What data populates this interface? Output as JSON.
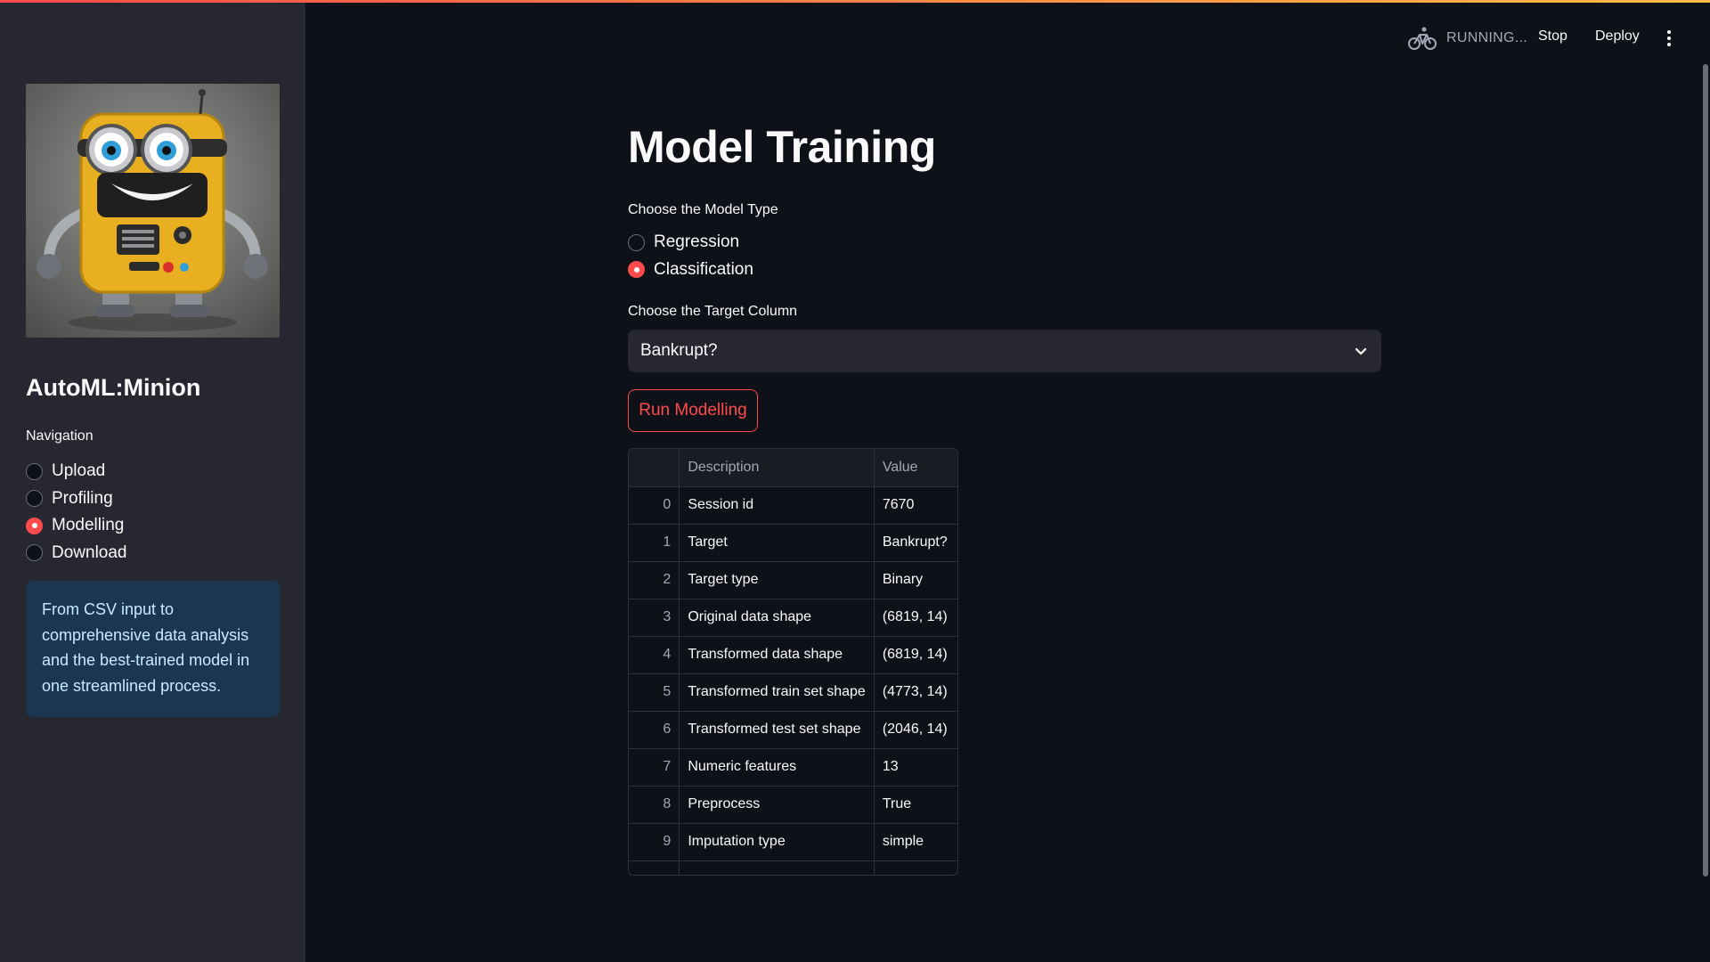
{
  "sidebar": {
    "app_title": "AutoML:Minion",
    "nav_label": "Navigation",
    "nav_items": [
      {
        "label": "Upload",
        "selected": false
      },
      {
        "label": "Profiling",
        "selected": false
      },
      {
        "label": "Modelling",
        "selected": true
      },
      {
        "label": "Download",
        "selected": false
      }
    ],
    "info_text": "From CSV input to comprehensive data analysis and the best-trained model in one streamlined process."
  },
  "header": {
    "status": "RUNNING...",
    "stop_label": "Stop",
    "deploy_label": "Deploy",
    "icons": [
      "running-bike-icon",
      "more-vertical-icon"
    ]
  },
  "main": {
    "title": "Model Training",
    "model_type_label": "Choose the Model Type",
    "model_types": [
      {
        "label": "Regression",
        "selected": false
      },
      {
        "label": "Classification",
        "selected": true
      }
    ],
    "target_label": "Choose the Target Column",
    "target_value": "Bankrupt?",
    "run_button": "Run Modelling"
  },
  "table": {
    "columns": [
      "",
      "Description",
      "Value"
    ],
    "rows": [
      {
        "index": "0",
        "description": "Session id",
        "value": "7670"
      },
      {
        "index": "1",
        "description": "Target",
        "value": "Bankrupt?"
      },
      {
        "index": "2",
        "description": "Target type",
        "value": "Binary"
      },
      {
        "index": "3",
        "description": "Original data shape",
        "value": "(6819, 14)"
      },
      {
        "index": "4",
        "description": "Transformed data shape",
        "value": "(6819, 14)"
      },
      {
        "index": "5",
        "description": "Transformed train set shape",
        "value": "(4773, 14)"
      },
      {
        "index": "6",
        "description": "Transformed test set shape",
        "value": "(2046, 14)"
      },
      {
        "index": "7",
        "description": "Numeric features",
        "value": "13"
      },
      {
        "index": "8",
        "description": "Preprocess",
        "value": "True"
      },
      {
        "index": "9",
        "description": "Imputation type",
        "value": "simple"
      }
    ]
  },
  "colors": {
    "background": "#0e1117",
    "sidebar": "#262730",
    "accent": "#ff4b4b",
    "info_bg": "#1c3550",
    "info_text": "#c7ebff"
  }
}
